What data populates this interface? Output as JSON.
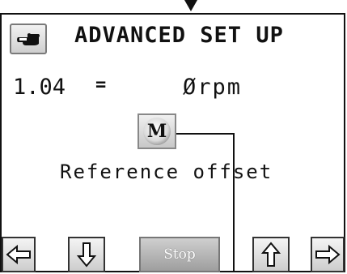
{
  "header": {
    "title": "ADVANCED SET UP",
    "back_icon": "hand-pointing-left-icon"
  },
  "parameter": {
    "id": "1.04",
    "equals": "=",
    "value": "Ørpm"
  },
  "mode_button": {
    "glyph": "M"
  },
  "description": "Reference offset",
  "footer": {
    "left_icon": "arrow-left-icon",
    "down_icon": "arrow-down-icon",
    "stop_label": "Stop",
    "up_icon": "arrow-up-icon",
    "right_icon": "arrow-right-icon"
  }
}
